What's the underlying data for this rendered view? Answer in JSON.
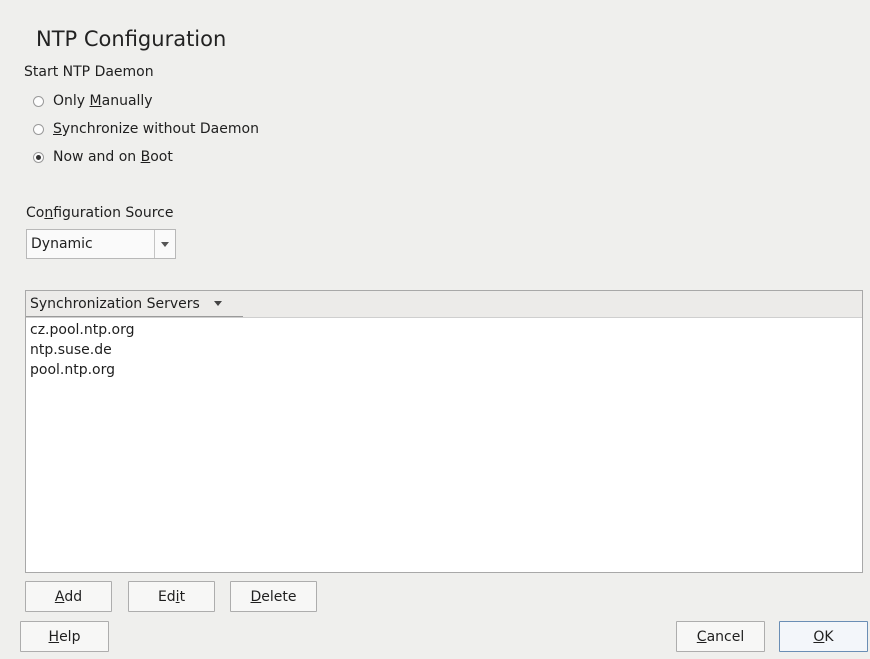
{
  "window": {
    "title": "NTP Configuration"
  },
  "start_daemon": {
    "label": "Start NTP Daemon",
    "options": [
      {
        "pre": "Only ",
        "key": "M",
        "post": "anually",
        "checked": false
      },
      {
        "pre": "",
        "key": "S",
        "post": "ynchronize without Daemon",
        "checked": false
      },
      {
        "pre": "Now and on ",
        "key": "B",
        "post": "oot",
        "checked": true
      }
    ]
  },
  "config_source": {
    "label_pre": "Co",
    "label_key": "n",
    "label_post": "figuration Source",
    "value": "Dynamic"
  },
  "servers": {
    "column_header": "Synchronization Servers",
    "rows": [
      "cz.pool.ntp.org",
      "ntp.suse.de",
      "pool.ntp.org"
    ]
  },
  "buttons": {
    "add": {
      "key": "A",
      "post": "dd"
    },
    "edit": {
      "pre": "Ed",
      "key": "i",
      "post": "t"
    },
    "delete": {
      "key": "D",
      "post": "elete"
    },
    "help": {
      "key": "H",
      "post": "elp"
    },
    "cancel": {
      "key": "C",
      "post": "ancel"
    },
    "ok": {
      "key": "O",
      "post": "K"
    }
  }
}
